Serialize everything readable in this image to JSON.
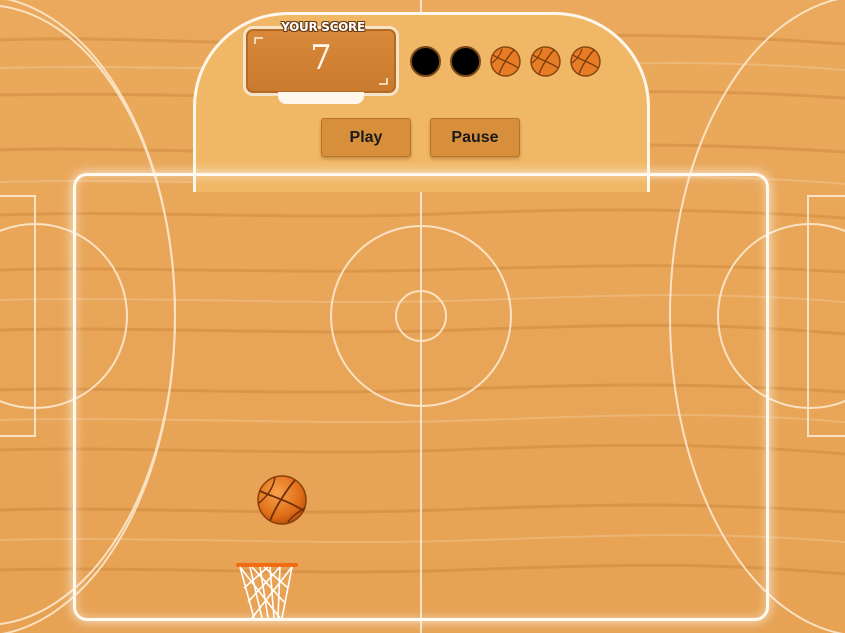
{
  "score": {
    "label": "YOUR SCORE",
    "value": "7"
  },
  "lives": {
    "total": 5,
    "used": 2,
    "remaining": 3
  },
  "controls": {
    "play_label": "Play",
    "pause_label": "Pause"
  },
  "colors": {
    "court": "#e9a659",
    "panel": "#f0b866",
    "button": "#d88f3c",
    "ball": "#e8761f",
    "rim": "#f26a12"
  },
  "icons": {
    "life_used": "black-dot",
    "life_remaining": "basketball-icon",
    "ball": "basketball-icon",
    "hoop": "basketball-hoop-icon"
  }
}
